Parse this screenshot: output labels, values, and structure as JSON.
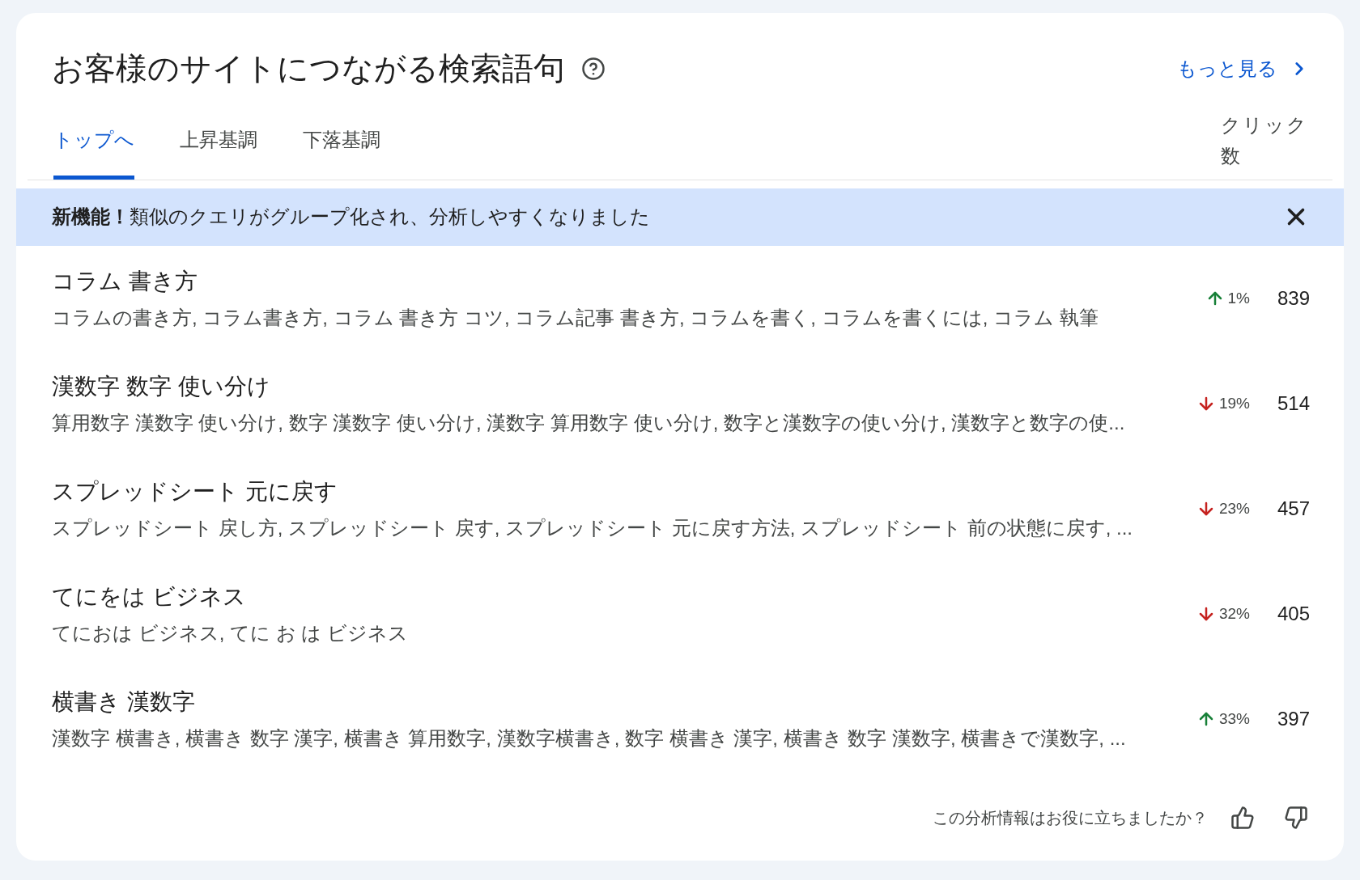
{
  "title": "お客様のサイトにつながる検索語句",
  "more_link": "もっと見る",
  "tabs": [
    {
      "label": "トップへ",
      "selected": true
    },
    {
      "label": "上昇基調",
      "selected": false
    },
    {
      "label": "下落基調",
      "selected": false
    }
  ],
  "column_header": "クリック数",
  "banner": {
    "text": "**新機能！**類似のクエリがグループ化され、分析しやすくなりました"
  },
  "rows": [
    {
      "query": "コラム 書き方",
      "related": "コラムの書き方, コラム書き方, コラム 書き方 コツ, コラム記事 書き方, コラムを書く, コラムを書くには, コラム 執筆",
      "kind": "up",
      "change": "1%",
      "clicks": "839"
    },
    {
      "query": "漢数字 数字 使い分け",
      "related": "算用数字 漢数字 使い分け, 数字 漢数字 使い分け, 漢数字 算用数字 使い分け, 数字と漢数字の使い分け, 漢数字と数字の使...",
      "kind": "down",
      "change": "19%",
      "clicks": "514"
    },
    {
      "query": "スプレッドシート 元に戻す",
      "related": "スプレッドシート 戻し方, スプレッドシート 戻す, スプレッドシート 元に戻す方法, スプレッドシート 前の状態に戻す, ...",
      "kind": "down",
      "change": "23%",
      "clicks": "457"
    },
    {
      "query": "てにをは ビジネス",
      "related": "てにおは ビジネス, てに お は ビジネス",
      "kind": "down",
      "change": "32%",
      "clicks": "405"
    },
    {
      "query": "横書き 漢数字",
      "related": "漢数字 横書き, 横書き 数字 漢字, 横書き 算用数字, 漢数字横書き, 数字 横書き 漢字, 横書き 数字 漢数字, 横書きで漢数字, ...",
      "kind": "up",
      "change": "33%",
      "clicks": "397"
    }
  ],
  "feedback": {
    "question": "この分析情報はお役に立ちましたか？"
  }
}
